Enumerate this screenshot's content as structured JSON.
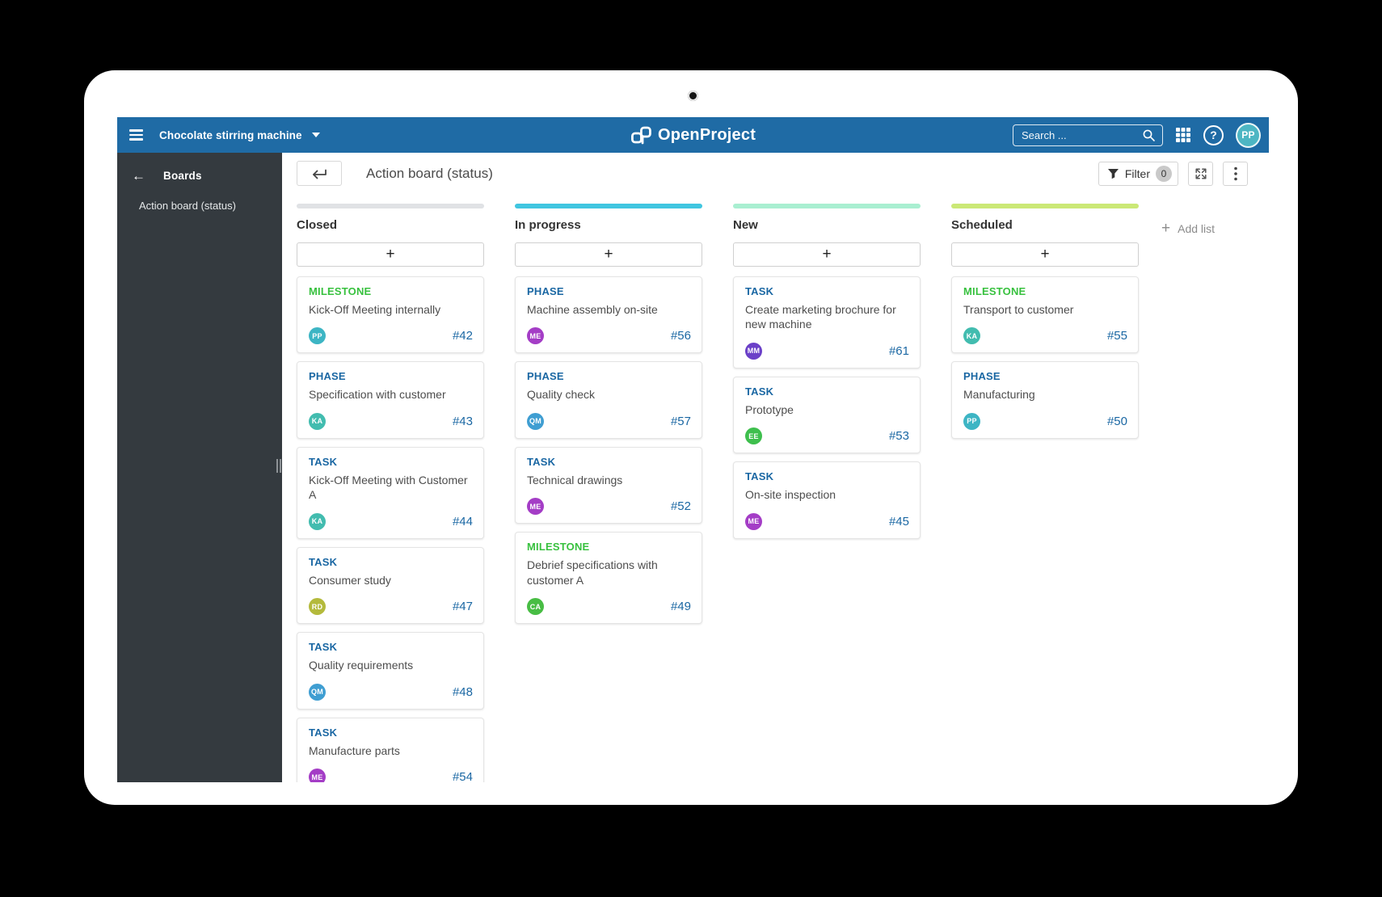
{
  "topbar": {
    "project_name": "Chocolate stirring machine",
    "logo_text": "OpenProject",
    "search_placeholder": "Search ...",
    "help_label": "?",
    "avatar_initials": "PP"
  },
  "sidebar": {
    "back_label": "Boards",
    "back_arrow": "←",
    "item_label": "Action board (status)"
  },
  "toolbar": {
    "title": "Action board (status)",
    "filter_label": "Filter",
    "filter_count": "0"
  },
  "board": {
    "add_card_label": "+",
    "add_list_label": "Add list",
    "add_list_plus": "+",
    "type_colors": {
      "MILESTONE": "#38c13f",
      "PHASE": "#1a67a3",
      "TASK": "#1a67a3"
    },
    "columns": [
      {
        "name": "Closed",
        "bar_color": "#e0e2e5",
        "cards": [
          {
            "type": "MILESTONE",
            "type_color": "#38c13f",
            "title": "Kick-Off Meeting internally",
            "avatar": {
              "initials": "PP",
              "color": "#3db5c4"
            },
            "id": "#42"
          },
          {
            "type": "PHASE",
            "type_color": "#1a67a3",
            "title": "Specification with customer",
            "avatar": {
              "initials": "KA",
              "color": "#42bcaf"
            },
            "id": "#43"
          },
          {
            "type": "TASK",
            "type_color": "#1a67a3",
            "title": "Kick-Off Meeting with Customer A",
            "avatar": {
              "initials": "KA",
              "color": "#42bcaf"
            },
            "id": "#44"
          },
          {
            "type": "TASK",
            "type_color": "#1a67a3",
            "title": "Consumer study",
            "avatar": {
              "initials": "RD",
              "color": "#b4ba3c"
            },
            "id": "#47"
          },
          {
            "type": "TASK",
            "type_color": "#1a67a3",
            "title": "Quality requirements",
            "avatar": {
              "initials": "QM",
              "color": "#3f9ed2"
            },
            "id": "#48"
          },
          {
            "type": "TASK",
            "type_color": "#1a67a3",
            "title": "Manufacture parts",
            "avatar": {
              "initials": "ME",
              "color": "#a43dc6"
            },
            "id": "#54"
          }
        ]
      },
      {
        "name": "In progress",
        "bar_color": "#40c6e0",
        "cards": [
          {
            "type": "PHASE",
            "type_color": "#1a67a3",
            "title": "Machine assembly on-site",
            "avatar": {
              "initials": "ME",
              "color": "#a43dc6"
            },
            "id": "#56"
          },
          {
            "type": "PHASE",
            "type_color": "#1a67a3",
            "title": "Quality check",
            "avatar": {
              "initials": "QM",
              "color": "#3f9ed2"
            },
            "id": "#57"
          },
          {
            "type": "TASK",
            "type_color": "#1a67a3",
            "title": "Technical drawings",
            "avatar": {
              "initials": "ME",
              "color": "#a43dc6"
            },
            "id": "#52"
          },
          {
            "type": "MILESTONE",
            "type_color": "#38c13f",
            "title": "Debrief specifications with customer A",
            "avatar": {
              "initials": "CA",
              "color": "#48bd44"
            },
            "id": "#49"
          }
        ]
      },
      {
        "name": "New",
        "bar_color": "#a9efd1",
        "cards": [
          {
            "type": "TASK",
            "type_color": "#1a67a3",
            "title": "Create marketing brochure for new machine",
            "avatar": {
              "initials": "MM",
              "color": "#6b40c8"
            },
            "id": "#61"
          },
          {
            "type": "TASK",
            "type_color": "#1a67a3",
            "title": "Prototype",
            "avatar": {
              "initials": "EE",
              "color": "#3ebf4d"
            },
            "id": "#53"
          },
          {
            "type": "TASK",
            "type_color": "#1a67a3",
            "title": "On-site inspection",
            "avatar": {
              "initials": "ME",
              "color": "#a43dc6"
            },
            "id": "#45"
          }
        ]
      },
      {
        "name": "Scheduled",
        "bar_color": "#cbe876",
        "cards": [
          {
            "type": "MILESTONE",
            "type_color": "#38c13f",
            "title": "Transport to customer",
            "avatar": {
              "initials": "KA",
              "color": "#42bcaf"
            },
            "id": "#55"
          },
          {
            "type": "PHASE",
            "type_color": "#1a67a3",
            "title": "Manufacturing",
            "avatar": {
              "initials": "PP",
              "color": "#3db5c4"
            },
            "id": "#50"
          }
        ]
      }
    ]
  },
  "colors": {
    "topbar": "#1f6ba5",
    "sidebar": "#343a3f",
    "link_blue": "#1a67a3",
    "milestone_green": "#38c13f"
  }
}
